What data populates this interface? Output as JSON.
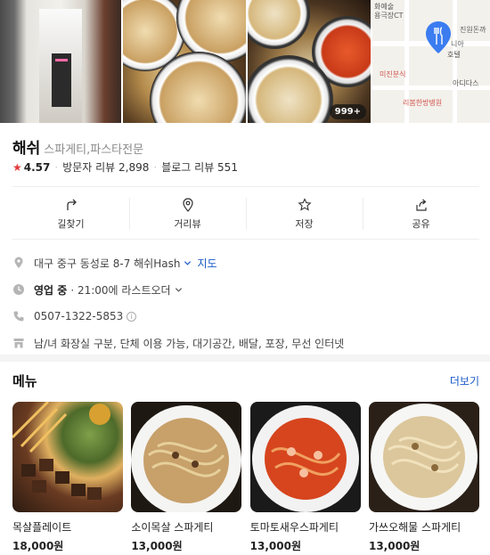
{
  "place": {
    "name": "해쉬",
    "category": "스파게티,파스타전문",
    "rating": "4.57",
    "visitor_reviews_label": "방문자 리뷰 2,898",
    "blog_reviews_label": "블로그 리뷰 551"
  },
  "photos": {
    "more_badge": "999+",
    "map_labels": [
      "미진분식",
      "리봄한방병원",
      "아디다스",
      "진원돈까",
      "용극장CT",
      "니아",
      "호텔",
      "화예술"
    ]
  },
  "actions": [
    {
      "label": "길찾기",
      "icon": "directions-icon"
    },
    {
      "label": "거리뷰",
      "icon": "location-pin-icon"
    },
    {
      "label": "저장",
      "icon": "star-outline-icon"
    },
    {
      "label": "공유",
      "icon": "share-icon"
    }
  ],
  "details": {
    "address": "대구 중구 동성로 8-7 해쉬Hash",
    "map_link": "지도",
    "status": "영업 중",
    "hours_note": "· 21:00에 라스트오더",
    "phone": "0507-1322-5853",
    "amenities": "남/녀 화장실 구분, 단체 이용 가능, 대기공간, 배달, 포장, 무선 인터넷"
  },
  "menu": {
    "title": "메뉴",
    "more_label": "더보기",
    "items": [
      {
        "name": "목살플레이트",
        "price": "18,000원"
      },
      {
        "name": "소이목살 스파게티",
        "price": "13,000원"
      },
      {
        "name": "토마토새우스파게티",
        "price": "13,000원"
      },
      {
        "name": "가쓰오해물 스파게티",
        "price": "13,000원"
      }
    ]
  },
  "colors": {
    "accent_link": "#1a5bc9",
    "star": "#e53b3b",
    "map_pin": "#3b7cf0"
  }
}
